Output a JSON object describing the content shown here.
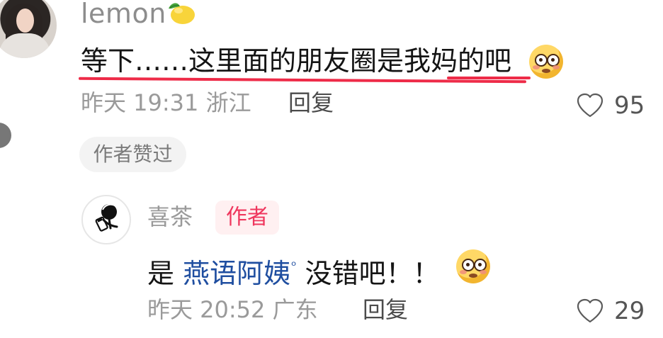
{
  "comment": {
    "username": "lemon",
    "username_emoji": "lemon-icon",
    "text": "等下……这里面的朋友圈是我妈的吧",
    "trailing_emoji": "flushed-face-icon",
    "meta": "昨天 19:31 浙江",
    "reply_label": "回复",
    "likes": "95",
    "author_liked_chip": "作者赞过"
  },
  "reply": {
    "author_name": "喜茶",
    "author_badge": "作者",
    "prefix": "是 ",
    "mention": "燕语阿姨",
    "mention_icon": "ᵒ",
    "suffix": " 没错吧！！",
    "trailing_emoji": "flushed-face-icon",
    "meta": "昨天 20:52 广东",
    "reply_label": "回复",
    "likes": "29"
  },
  "colors": {
    "underline": "#ee2b48",
    "author_badge_text": "#ef365d",
    "mention": "#1f4ea0"
  }
}
